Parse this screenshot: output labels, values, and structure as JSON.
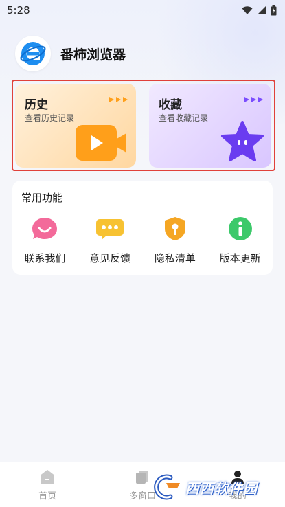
{
  "status_bar": {
    "time": "5:28"
  },
  "app": {
    "name": "番柿浏览器"
  },
  "cards": {
    "history": {
      "title": "历史",
      "subtitle": "查看历史记录"
    },
    "favorites": {
      "title": "收藏",
      "subtitle": "查看收藏记录"
    }
  },
  "functions": {
    "title": "常用功能",
    "items": [
      {
        "label": "联系我们",
        "icon": "contact-icon",
        "color": "#f36a9a"
      },
      {
        "label": "意见反馈",
        "icon": "feedback-icon",
        "color": "#f7c232"
      },
      {
        "label": "隐私清单",
        "icon": "privacy-shield-icon",
        "color": "#f5a623"
      },
      {
        "label": "版本更新",
        "icon": "info-icon",
        "color": "#3cc96a"
      }
    ]
  },
  "bottom_nav": {
    "items": [
      {
        "label": "首页",
        "icon": "home-icon"
      },
      {
        "label": "多窗口",
        "icon": "windows-icon"
      },
      {
        "label": "我的",
        "icon": "profile-icon"
      }
    ]
  },
  "watermark": {
    "text": "西西软件园"
  },
  "colors": {
    "highlight_border": "#e0413a",
    "history_accent": "#ff9f1a",
    "favorites_accent": "#7b4dff"
  }
}
